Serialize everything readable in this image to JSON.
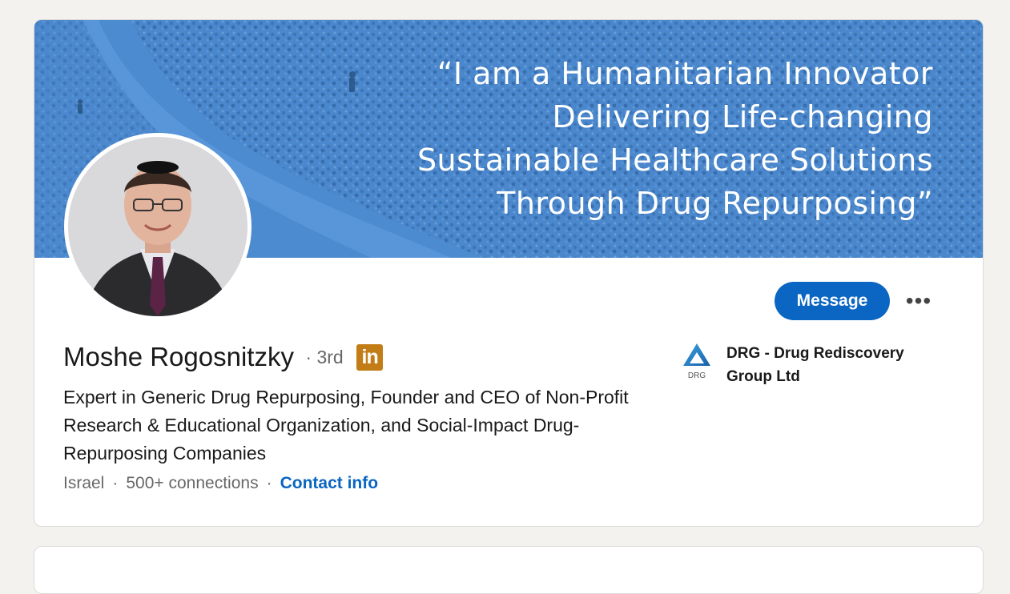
{
  "banner": {
    "lines": [
      "“I am a Humanitarian Innovator",
      "Delivering Life-changing",
      "Sustainable Healthcare Solutions",
      "Through Drug Repurposing”"
    ]
  },
  "profile": {
    "name": "Moshe Rogosnitzky",
    "dot": "·",
    "degree": "3rd",
    "badge": "in",
    "headline": "Expert in Generic Drug Repurposing, Founder and CEO of Non-Profit Research & Educational Organization, and Social-Impact Drug-Repurposing Companies",
    "location": "Israel",
    "connections": "500+ connections",
    "contact_info": "Contact info"
  },
  "actions": {
    "message_label": "Message",
    "more_label": "•••"
  },
  "company": {
    "name": "DRG - Drug Rediscovery Group Ltd",
    "logo_text": "DRG"
  },
  "colors": {
    "banner": "#4d8bd0",
    "primary": "#0a66c2",
    "badge": "#c37d16",
    "background": "#f3f2ef"
  }
}
